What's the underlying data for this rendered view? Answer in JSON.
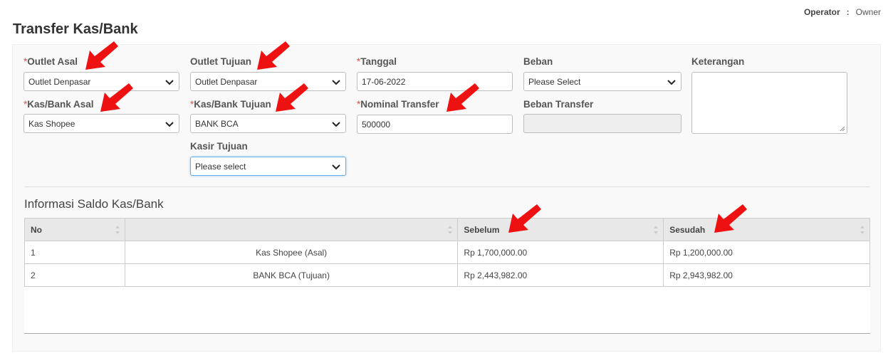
{
  "header": {
    "operator_label": "Operator",
    "operator_colon": ":",
    "operator_value": "Owner",
    "page_title": "Transfer Kas/Bank"
  },
  "form": {
    "required_mark": "*",
    "outlet_asal": {
      "label": "Outlet Asal",
      "value": "Outlet Denpasar"
    },
    "outlet_tujuan": {
      "label": "Outlet Tujuan",
      "value": "Outlet Denpasar"
    },
    "tanggal": {
      "label": "Tanggal",
      "value": "17-06-2022"
    },
    "beban": {
      "label": "Beban",
      "value": "Please Select"
    },
    "keterangan": {
      "label": "Keterangan",
      "value": ""
    },
    "kas_bank_asal": {
      "label": "Kas/Bank Asal",
      "value": "Kas Shopee"
    },
    "kas_bank_tujuan": {
      "label": "Kas/Bank Tujuan",
      "value": "BANK BCA"
    },
    "nominal_transfer": {
      "label": "Nominal Transfer",
      "value": "500000"
    },
    "beban_transfer": {
      "label": "Beban Transfer",
      "value": ""
    },
    "kasir_tujuan": {
      "label": "Kasir Tujuan",
      "value": "Please select"
    }
  },
  "saldo": {
    "title": "Informasi Saldo Kas/Bank",
    "columns": [
      "No",
      "",
      "Sebelum",
      "Sesudah"
    ],
    "rows": [
      {
        "no": "1",
        "name": "Kas Shopee (Asal)",
        "sebelum": "Rp 1,700,000.00",
        "sesudah": "Rp 1,200,000.00"
      },
      {
        "no": "2",
        "name": "BANK BCA (Tujuan)",
        "sebelum": "Rp 2,443,982.00",
        "sesudah": "Rp 2,943,982.00"
      }
    ]
  },
  "colors": {
    "arrow": "#ee1111",
    "required": "#d9534f",
    "focus": "#66afe9"
  },
  "icons": [
    "chevron-down-icon",
    "sort-icon",
    "red-arrow-annotation-icon",
    "resize-handle-icon"
  ]
}
